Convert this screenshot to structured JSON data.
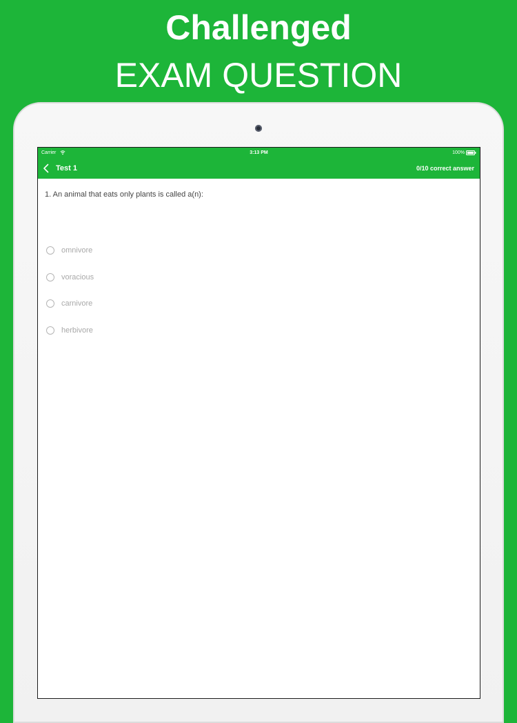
{
  "promo": {
    "line1": "Challenged",
    "line2": "EXAM QUESTION"
  },
  "status_bar": {
    "carrier": "Carrier",
    "time": "3:13 PM",
    "battery": "100%"
  },
  "nav": {
    "title": "Test 1",
    "score": "0/10 correct answer"
  },
  "question": {
    "text": "1. An animal that eats only plants is called a(n):",
    "options": [
      {
        "label": "omnivore"
      },
      {
        "label": "voracious"
      },
      {
        "label": "carnivore"
      },
      {
        "label": "herbivore"
      }
    ]
  },
  "colors": {
    "brand_green": "#1db539",
    "option_text": "#a8a8a8",
    "question_text": "#444444"
  }
}
